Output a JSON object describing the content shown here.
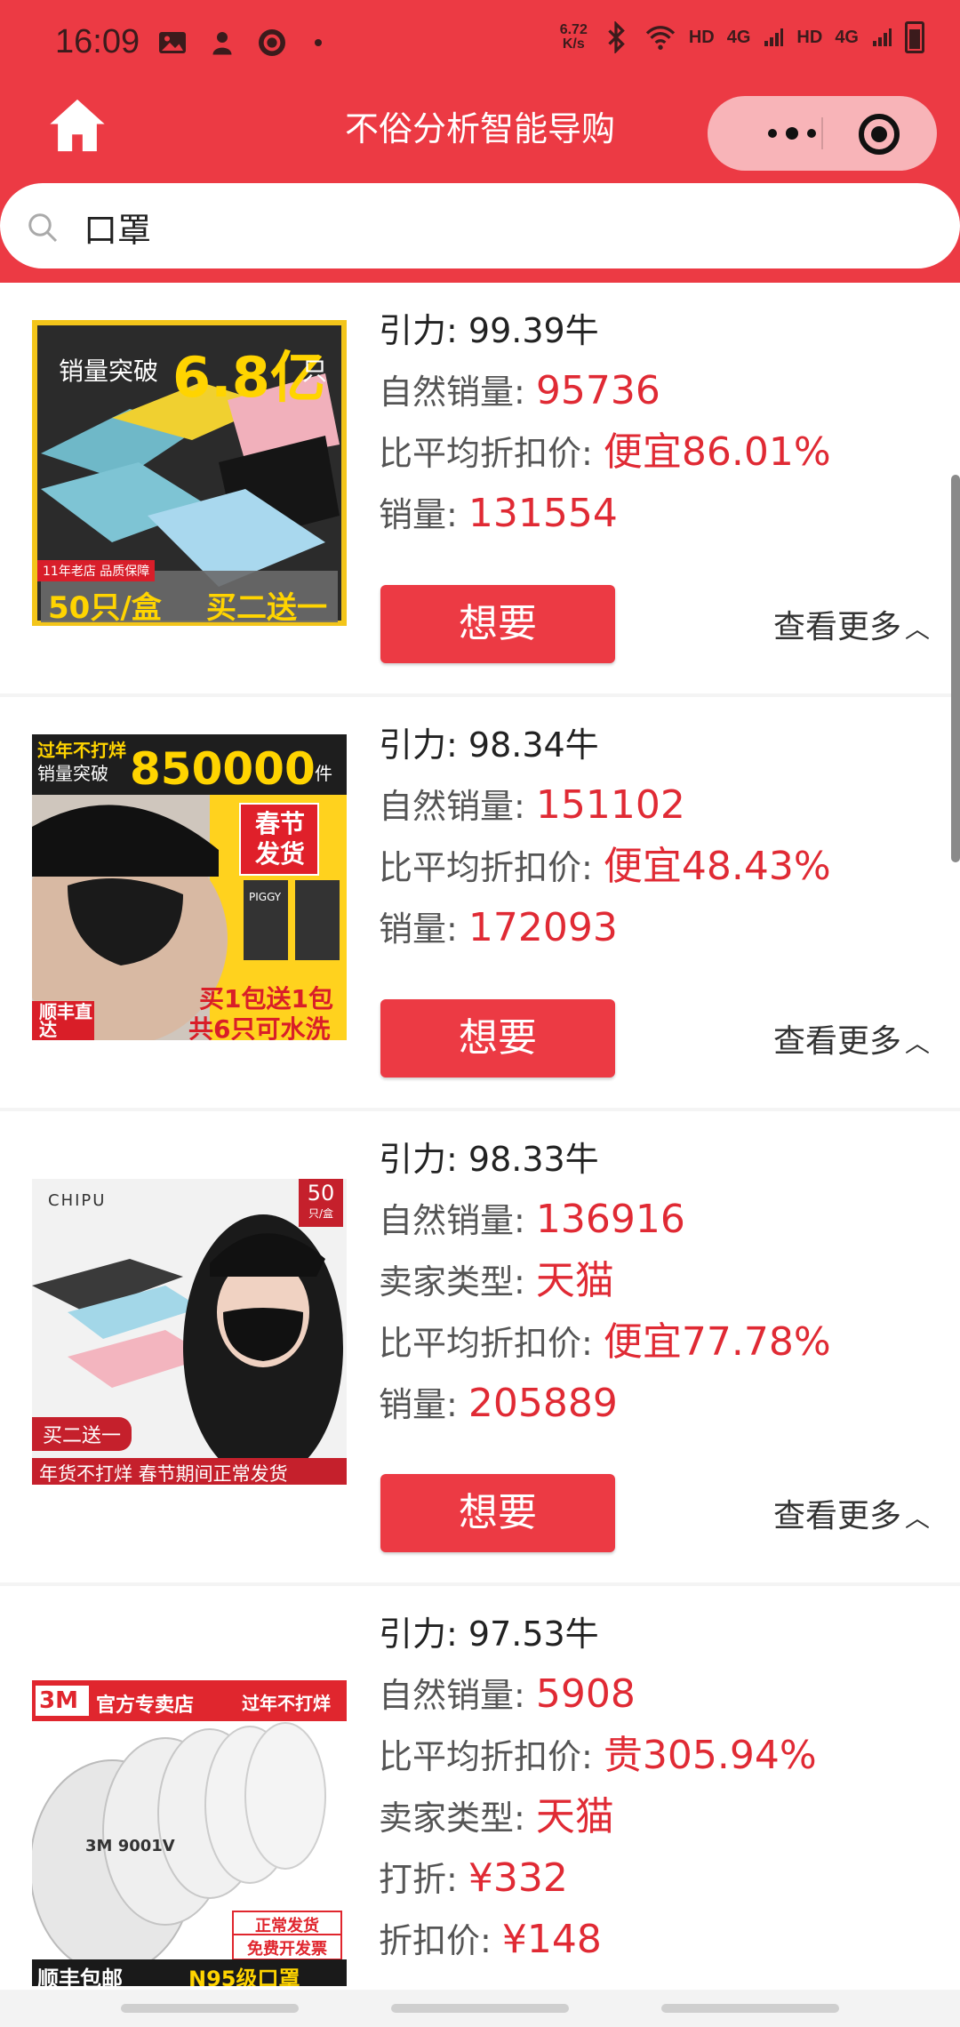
{
  "status": {
    "time": "16:09",
    "netspeed_value": "6.72",
    "netspeed_unit": "K/s",
    "hd1": "HD",
    "sig1": "4G",
    "hd2": "HD",
    "sig2": "4G"
  },
  "nav": {
    "title": "不俗分析智能导购"
  },
  "search": {
    "query": "口罩"
  },
  "products": [
    {
      "rows": [
        {
          "label": "引力: ",
          "value": "99.39牛"
        },
        {
          "label": "自然销量: ",
          "value": "95736"
        },
        {
          "label": "比平均折扣价: ",
          "value": "便宜86.01%"
        },
        {
          "label": "销量: ",
          "value": "131554"
        }
      ],
      "thumb_text": {
        "top": "销量突破",
        "big": "6.8亿",
        "unit": "只",
        "bottom_left": "50只/盒",
        "bottom_right": "买二送一",
        "badge": "11年老店 品质保障"
      }
    },
    {
      "rows": [
        {
          "label": "引力: ",
          "value": "98.34牛"
        },
        {
          "label": "自然销量: ",
          "value": "151102"
        },
        {
          "label": "比平均折扣价: ",
          "value": "便宜48.43%"
        },
        {
          "label": "销量: ",
          "value": "172093"
        }
      ],
      "thumb_text": {
        "corner": "过年不打烊",
        "top": "销量突破",
        "big": "850000",
        "unit": "件",
        "badge": "春节发货",
        "bottom_left": "顺丰直达",
        "bottom_right": "买1包送1包",
        "bottom_right2": "共6只可水洗",
        "brand": "PIGGY"
      }
    },
    {
      "rows": [
        {
          "label": "引力: ",
          "value": "98.33牛"
        },
        {
          "label": "自然销量: ",
          "value": "136916"
        },
        {
          "label": "卖家类型: ",
          "value": "天猫"
        },
        {
          "label": "比平均折扣价: ",
          "value": "便宜77.78%"
        },
        {
          "label": "销量: ",
          "value": "205889"
        }
      ],
      "thumb_text": {
        "brand": "CHIPU",
        "count": "50",
        "count_unit": "只/盒",
        "promo": "买二送一",
        "bottom": "年货不打烊 春节期间正常发货"
      }
    },
    {
      "rows": [
        {
          "label": "引力: ",
          "value": "97.53牛"
        },
        {
          "label": "自然销量: ",
          "value": "5908"
        },
        {
          "label": "比平均折扣价: ",
          "value": "贵305.94%"
        },
        {
          "label": "卖家类型: ",
          "value": "天猫"
        },
        {
          "label": "打折: ",
          "value": "¥332"
        },
        {
          "label": "折扣价: ",
          "value": "¥148"
        }
      ],
      "thumb_text": {
        "brand_box": "3M",
        "store": "官方专卖店",
        "corner": "过年不打烊",
        "model": "3M 9001V",
        "badge1": "正常发货",
        "badge2": "免费开发票",
        "bottom_left": "顺丰包邮",
        "bottom_right": "N95级口罩"
      }
    }
  ],
  "buttons": {
    "want": "想要",
    "more": "查看更多"
  },
  "colors": {
    "brand_red": "#ec3a44",
    "value_red": "#e02a34"
  }
}
